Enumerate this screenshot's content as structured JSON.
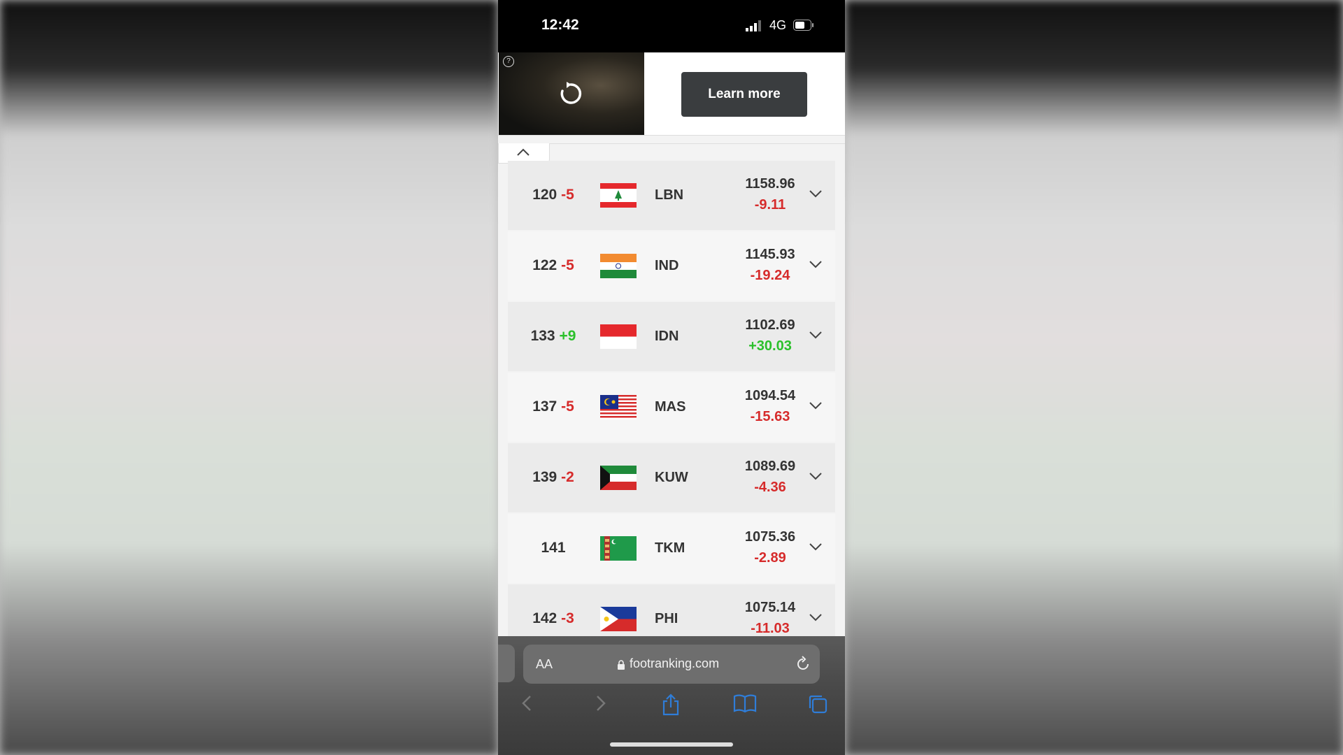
{
  "status_bar": {
    "time": "12:42",
    "network": "4G",
    "signal_icon": "cellular-signal-icon",
    "battery_icon": "battery-icon"
  },
  "ad": {
    "help_symbol": "?",
    "replay_icon": "replay-icon",
    "cta_label": "Learn more"
  },
  "collapse_icon": "chevron-up-icon",
  "rankings": [
    {
      "rank": "120",
      "change": "-5",
      "change_dir": "neg",
      "flag": "lebanon-flag",
      "code": "LBN",
      "points": "1158.96",
      "delta": "-9.11",
      "delta_dir": "neg"
    },
    {
      "rank": "122",
      "change": "-5",
      "change_dir": "neg",
      "flag": "india-flag",
      "code": "IND",
      "points": "1145.93",
      "delta": "-19.24",
      "delta_dir": "neg"
    },
    {
      "rank": "133",
      "change": "+9",
      "change_dir": "pos",
      "flag": "indonesia-flag",
      "code": "IDN",
      "points": "1102.69",
      "delta": "+30.03",
      "delta_dir": "pos"
    },
    {
      "rank": "137",
      "change": "-5",
      "change_dir": "neg",
      "flag": "malaysia-flag",
      "code": "MAS",
      "points": "1094.54",
      "delta": "-15.63",
      "delta_dir": "neg"
    },
    {
      "rank": "139",
      "change": "-2",
      "change_dir": "neg",
      "flag": "kuwait-flag",
      "code": "KUW",
      "points": "1089.69",
      "delta": "-4.36",
      "delta_dir": "neg"
    },
    {
      "rank": "141",
      "change": "",
      "change_dir": "none",
      "flag": "turkmenistan-flag",
      "code": "TKM",
      "points": "1075.36",
      "delta": "-2.89",
      "delta_dir": "neg"
    },
    {
      "rank": "142",
      "change": "-3",
      "change_dir": "neg",
      "flag": "philippines-flag",
      "code": "PHI",
      "points": "1075.14",
      "delta": "-11.03",
      "delta_dir": "neg"
    }
  ],
  "browser": {
    "text_size_label": "AA",
    "url": "footranking.com",
    "icons": [
      "back-icon",
      "forward-icon",
      "share-icon",
      "bookmarks-icon",
      "tabs-icon"
    ]
  },
  "colors": {
    "negative": "#d62b2b",
    "positive": "#2bc02b",
    "cta_bg": "#3a3d3f"
  }
}
